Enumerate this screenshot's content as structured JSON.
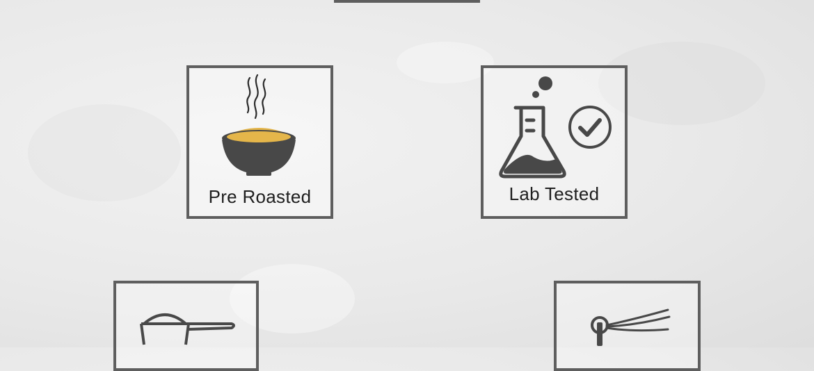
{
  "colors": {
    "frame": "#5e5e5e",
    "icon": "#484848",
    "powder": "#e5b64a",
    "text": "#1e1e1e"
  },
  "tiles": [
    {
      "label": "Pre Roasted",
      "icon": "steaming-bowl-icon"
    },
    {
      "label": "Lab Tested",
      "icon": "flask-check-icon"
    },
    {
      "label": "",
      "icon": "measuring-scoop-icon"
    },
    {
      "label": "",
      "icon": "whisk-icon"
    }
  ]
}
